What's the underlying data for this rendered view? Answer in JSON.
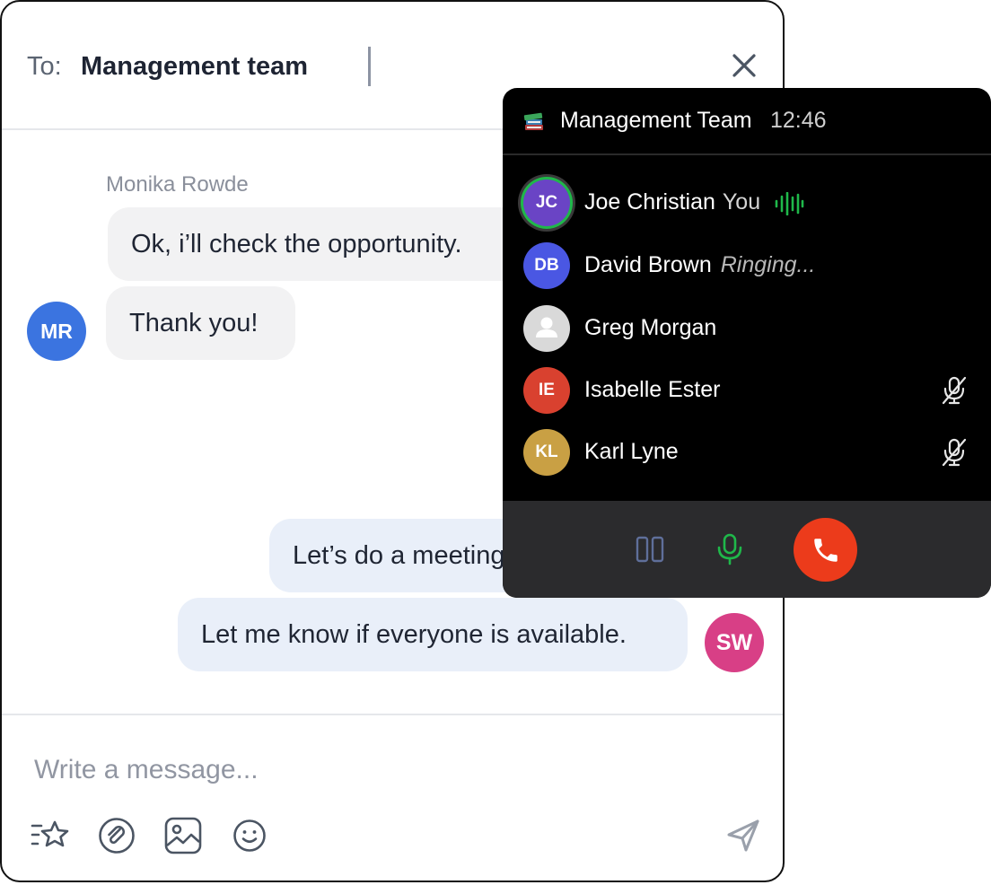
{
  "chat": {
    "to_label": "To:",
    "recipient": "Management team",
    "messages": [
      {
        "sender": "Monika Rowde",
        "text": "Ok, i’ll check the opportunity."
      },
      {
        "text": "Thank you!"
      },
      {
        "text": "Let’s do a meeting"
      },
      {
        "text": "Let me know if everyone is available."
      }
    ],
    "avatars": {
      "incoming": "MR",
      "outgoing": "SW"
    },
    "composer_placeholder": "Write a message..."
  },
  "call": {
    "title": "Management Team",
    "time": "12:46",
    "participants": [
      {
        "initials": "JC",
        "name": "Joe Christian",
        "tag": "You",
        "status": "",
        "color": "#6a44c5",
        "speaking": true,
        "muted": false
      },
      {
        "initials": "DB",
        "name": "David Brown",
        "tag": "",
        "status": "Ringing...",
        "color": "#4a57e3",
        "speaking": false,
        "muted": false
      },
      {
        "initials": "",
        "name": "Greg Morgan",
        "tag": "",
        "status": "",
        "color": "#d9d9d9",
        "speaking": false,
        "muted": false
      },
      {
        "initials": "IE",
        "name": "Isabelle Ester",
        "tag": "",
        "status": "",
        "color": "#d9412f",
        "speaking": false,
        "muted": true
      },
      {
        "initials": "KL",
        "name": "Karl Lyne",
        "tag": "",
        "status": "",
        "color": "#c9a044",
        "speaking": false,
        "muted": true
      }
    ],
    "colors": {
      "accent_green": "#1fb84a",
      "hangup_red": "#ec3b1b",
      "panel_bg": "#000000"
    }
  }
}
